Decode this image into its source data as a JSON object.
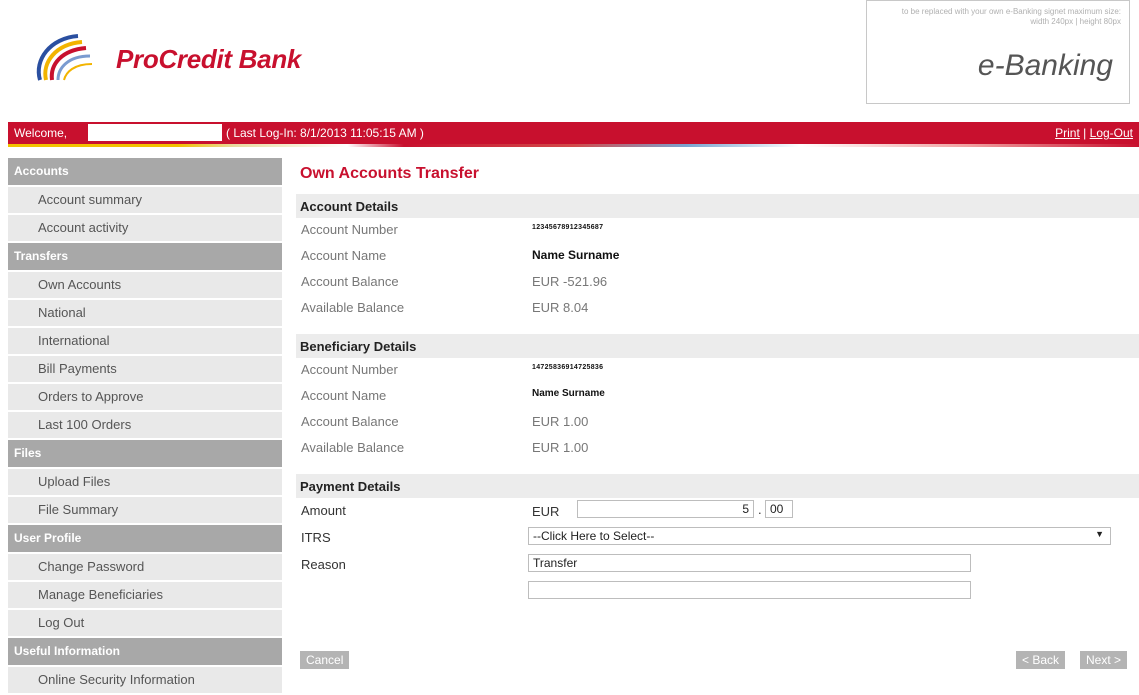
{
  "header": {
    "bank_name": "ProCredit Bank",
    "ebanking_note": "to be replaced with your own e-Banking signet maximum size: width 240px | height 80px",
    "ebanking_title": "e-Banking"
  },
  "welcome_bar": {
    "welcome": "Welcome,",
    "last_login": "( Last Log-In: 8/1/2013 11:05:15 AM )",
    "print": "Print",
    "separator": "|",
    "logout": "Log-Out"
  },
  "sidebar": {
    "sections": [
      {
        "title": "Accounts",
        "items": [
          "Account summary",
          "Account activity"
        ]
      },
      {
        "title": "Transfers",
        "items": [
          "Own Accounts",
          "National",
          "International",
          "Bill Payments",
          "Orders to Approve",
          "Last 100 Orders"
        ]
      },
      {
        "title": "Files",
        "items": [
          "Upload Files",
          "File Summary"
        ]
      },
      {
        "title": "User Profile",
        "items": [
          "Change Password",
          "Manage Beneficiaries",
          "Log Out"
        ]
      },
      {
        "title": "Useful Information",
        "items": [
          "Online Security Information"
        ]
      }
    ]
  },
  "main": {
    "title": "Own Accounts Transfer",
    "account_details": {
      "heading": "Account Details",
      "rows": [
        {
          "label": "Account Number",
          "value": "12345678912345687"
        },
        {
          "label": "Account Name",
          "value": "Name Surname"
        },
        {
          "label": "Account Balance",
          "value": "EUR -521.96"
        },
        {
          "label": "Available Balance",
          "value": "EUR 8.04"
        }
      ]
    },
    "beneficiary_details": {
      "heading": "Beneficiary Details",
      "rows": [
        {
          "label": "Account Number",
          "value": "14725836914725836"
        },
        {
          "label": "Account Name",
          "value": "Name Surname"
        },
        {
          "label": "Account Balance",
          "value": "EUR 1.00"
        },
        {
          "label": "Available Balance",
          "value": "EUR 1.00"
        }
      ]
    },
    "payment_details": {
      "heading": "Payment Details",
      "amount_label": "Amount",
      "currency": "EUR",
      "amount_whole": "5",
      "decimal_sep": ".",
      "amount_cents": "00",
      "itrs_label": "ITRS",
      "itrs_selected": "--Click Here to Select--",
      "reason_label": "Reason",
      "reason_value": "Transfer",
      "reason_value_2": ""
    },
    "buttons": {
      "cancel": "Cancel",
      "back": "< Back",
      "next": "Next >"
    }
  },
  "colors": {
    "brand_red": "#c8102e",
    "sidebar_head": "#a8a8a8",
    "sidebar_item": "#e9e9e9"
  }
}
